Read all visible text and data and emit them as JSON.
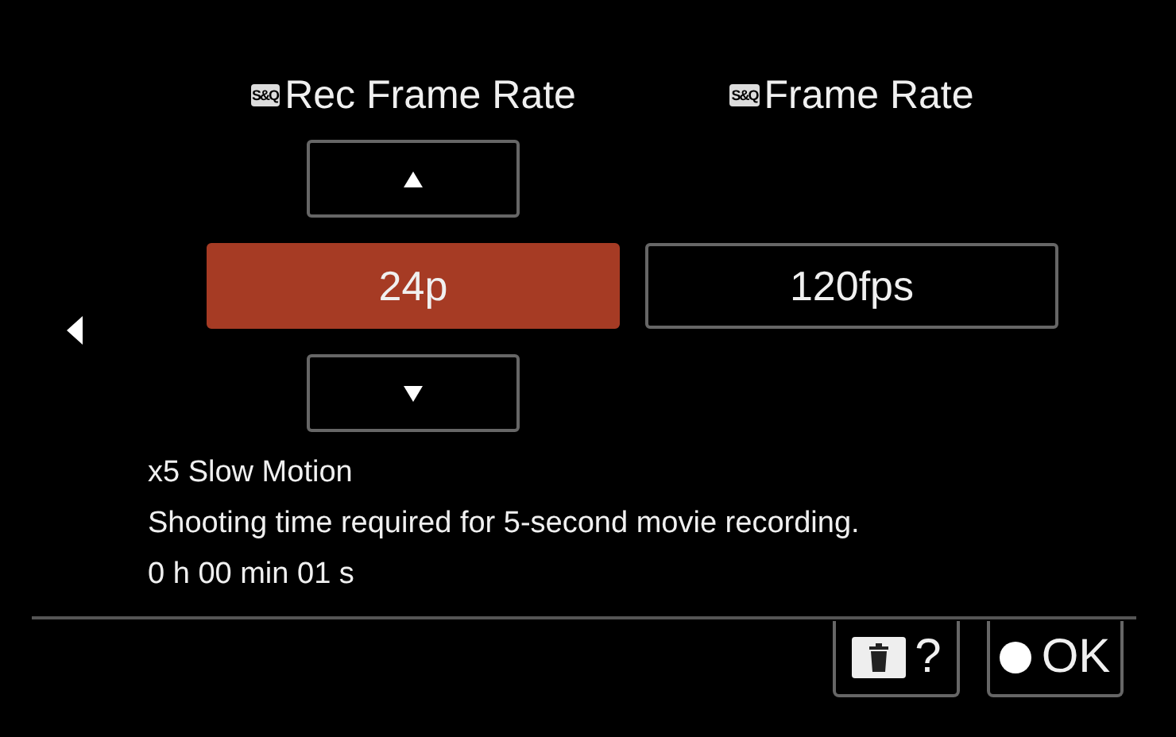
{
  "columns": [
    {
      "badge": "S&Q",
      "title": "Rec Frame Rate",
      "value": "24p",
      "selected": true
    },
    {
      "badge": "S&Q",
      "title": "Frame Rate",
      "value": "120fps",
      "selected": false
    }
  ],
  "info": [
    "x5 Slow Motion",
    "Shooting time required for 5-second movie recording.",
    "0 h 00 min 01 s"
  ],
  "buttons": [
    {
      "kind": "delete",
      "label": "?"
    },
    {
      "kind": "ok",
      "label": "OK"
    }
  ]
}
